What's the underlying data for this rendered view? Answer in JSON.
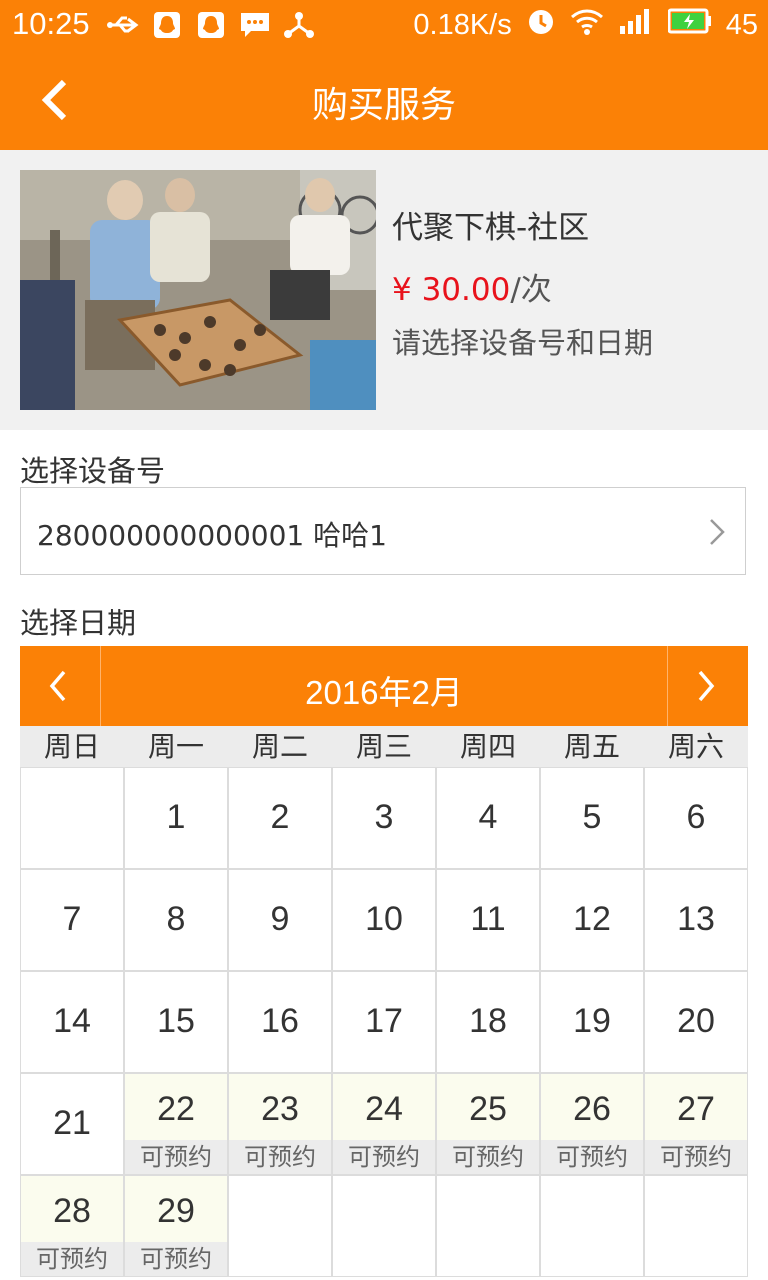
{
  "status_bar": {
    "time": "10:25",
    "net_speed": "0.18K/s",
    "battery": "45",
    "icons": [
      "usb-icon",
      "qq-icon",
      "qq-icon",
      "message-icon",
      "share-icon",
      "alarm-icon",
      "wifi-icon",
      "signal-4g-icon",
      "battery-charging-icon"
    ]
  },
  "navbar": {
    "title": "购买服务"
  },
  "product": {
    "name": "代聚下棋-社区",
    "price_symbol": "¥ ",
    "price_amount": "30.00",
    "price_unit": "/次",
    "hint": "请选择设备号和日期"
  },
  "device": {
    "label": "选择设备号",
    "value": "280000000000001 哈哈1"
  },
  "date": {
    "label": "选择日期",
    "month_title": "2016年2月",
    "weekdays": [
      "周日",
      "周一",
      "周二",
      "周三",
      "周四",
      "周五",
      "周六"
    ],
    "available_label": "可预约",
    "weeks": [
      [
        null,
        "1",
        "2",
        "3",
        "4",
        "5",
        "6"
      ],
      [
        "7",
        "8",
        "9",
        "10",
        "11",
        "12",
        "13"
      ],
      [
        "14",
        "15",
        "16",
        "17",
        "18",
        "19",
        "20"
      ],
      [
        "21",
        "22",
        "23",
        "24",
        "25",
        "26",
        "27"
      ],
      [
        "28",
        "29",
        null,
        null,
        null,
        null,
        null
      ]
    ],
    "available_days": [
      "22",
      "23",
      "24",
      "25",
      "26",
      "27",
      "28",
      "29"
    ]
  },
  "colors": {
    "accent": "#fb8106",
    "price": "#e8121b",
    "available_bg": "#fbfcee"
  }
}
